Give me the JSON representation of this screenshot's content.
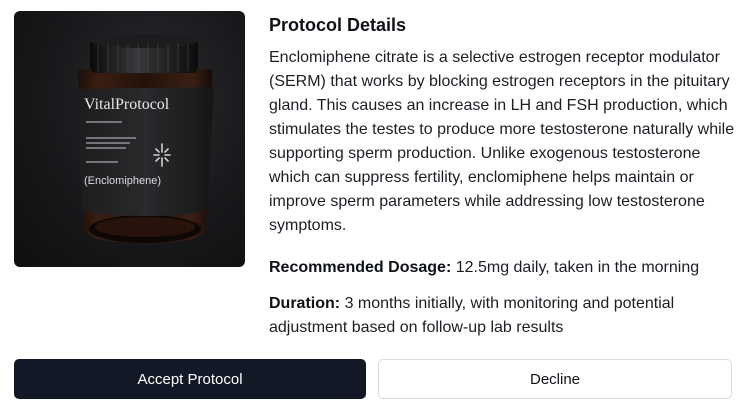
{
  "product": {
    "brand_text": "VitalProtocol",
    "bottle_label": "(Enclomiphene)"
  },
  "details": {
    "title": "Protocol Details",
    "description": "Enclomiphene citrate is a selective estrogen receptor modulator (SERM) that works by blocking estrogen receptors in the pituitary gland. This causes an increase in LH and FSH production, which stimulates the testes to produce more testosterone naturally while supporting sperm production. Unlike exogenous testosterone which can suppress fertility, enclomiphene helps maintain or improve sperm parameters while addressing low testosterone symptoms.",
    "dosage_label": "Recommended Dosage:",
    "dosage_value": "12.5mg daily, taken in the morning",
    "duration_label": "Duration:",
    "duration_value": "3 months initially, with monitoring and potential adjustment based on follow-up lab results"
  },
  "actions": {
    "accept_label": "Accept Protocol",
    "decline_label": "Decline"
  },
  "colors": {
    "accept_button": "#131827",
    "decline_border": "#d8dbe0"
  }
}
